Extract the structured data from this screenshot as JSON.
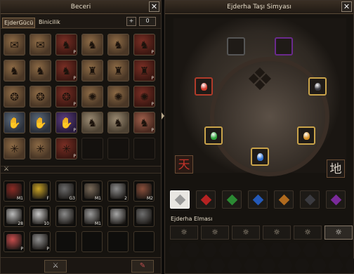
{
  "skills_window": {
    "title": "Beceri",
    "close_label": "✕",
    "tabs": [
      {
        "label": "EjderGücü"
      },
      {
        "label": "Binicilik"
      }
    ],
    "plus_label": "+",
    "skill_points": "0",
    "skill_rows": [
      [
        {
          "kind": "a",
          "icon": "scroll-icon",
          "label": ""
        },
        {
          "kind": "a",
          "icon": "scroll-icon",
          "label": ""
        },
        {
          "kind": "b",
          "icon": "dragon-icon",
          "label": "P"
        },
        {
          "kind": "a",
          "icon": "dragon-icon",
          "label": ""
        },
        {
          "kind": "a",
          "icon": "dragon-icon",
          "label": ""
        },
        {
          "kind": "b",
          "icon": "dragon-icon",
          "label": "P"
        }
      ],
      [
        {
          "kind": "a",
          "icon": "dragon-icon",
          "label": ""
        },
        {
          "kind": "a",
          "icon": "dragon-icon",
          "label": ""
        },
        {
          "kind": "b",
          "icon": "dragon-icon",
          "label": "P"
        },
        {
          "kind": "a",
          "icon": "totem-icon",
          "label": ""
        },
        {
          "kind": "a",
          "icon": "totem-icon",
          "label": ""
        },
        {
          "kind": "b",
          "icon": "totem-icon",
          "label": "P"
        }
      ],
      [
        {
          "kind": "a",
          "icon": "rune-icon",
          "label": ""
        },
        {
          "kind": "a",
          "icon": "rune-icon",
          "label": ""
        },
        {
          "kind": "b",
          "icon": "rune-icon",
          "label": "P"
        },
        {
          "kind": "a",
          "icon": "spiral-icon",
          "label": ""
        },
        {
          "kind": "a",
          "icon": "spiral-icon",
          "label": ""
        },
        {
          "kind": "b",
          "icon": "spiral-icon",
          "label": "P"
        }
      ],
      [
        {
          "kind": "c",
          "icon": "claw-icon",
          "label": ""
        },
        {
          "kind": "c",
          "icon": "claw-icon",
          "label": ""
        },
        {
          "kind": "e",
          "icon": "claw-icon",
          "label": "P"
        },
        {
          "kind": "d",
          "icon": "beast-icon",
          "label": ""
        },
        {
          "kind": "d",
          "icon": "beast-icon",
          "label": ""
        },
        {
          "kind": "f",
          "icon": "beast-icon",
          "label": "P"
        }
      ],
      [
        {
          "kind": "a",
          "icon": "web-icon",
          "label": ""
        },
        {
          "kind": "a",
          "icon": "web-icon",
          "label": ""
        },
        {
          "kind": "b",
          "icon": "web-icon",
          "label": "P"
        },
        {
          "kind": "empty",
          "icon": "",
          "label": ""
        },
        {
          "kind": "empty",
          "icon": "",
          "label": ""
        },
        {
          "kind": "empty",
          "icon": "",
          "label": ""
        }
      ]
    ],
    "items": [
      [
        {
          "icon": "sword-slot-icon",
          "label": "M1",
          "color": "#8a2a24"
        },
        {
          "icon": "yellow-gem-icon",
          "label": "F",
          "color": "#c9a326"
        },
        {
          "icon": "flag-icon",
          "label": "G3",
          "color": "#6b6b6b"
        },
        {
          "icon": "flag-up-icon",
          "label": "M1",
          "color": "#7a6b5a"
        },
        {
          "icon": "armor-icon",
          "label": "2",
          "color": "#8c8c8c"
        },
        {
          "icon": "knot-icon",
          "label": "M2",
          "color": "#8a4f3b"
        }
      ],
      [
        {
          "icon": "horse-icon",
          "label": "28",
          "color": "#bbbbbb"
        },
        {
          "icon": "helm-icon",
          "label": "10",
          "color": "#c8c8c8"
        },
        {
          "icon": "bow-icon",
          "label": "",
          "color": "#8a8a8a"
        },
        {
          "icon": "blade-icon",
          "label": "M1",
          "color": "#9a9a9a"
        },
        {
          "icon": "arrows-icon",
          "label": "",
          "color": "#a6a6a6"
        },
        {
          "icon": "scroll-slot-icon",
          "label": "",
          "color": "#6e6e6e"
        }
      ],
      [
        {
          "icon": "target-icon",
          "label": "P",
          "color": "#c84d4d"
        },
        {
          "icon": "cross-swords-icon",
          "label": "P",
          "color": "#909090"
        },
        {
          "icon": "",
          "label": "",
          "color": ""
        },
        {
          "icon": "",
          "label": "",
          "color": ""
        },
        {
          "icon": "",
          "label": "",
          "color": ""
        },
        {
          "icon": "",
          "label": "",
          "color": ""
        }
      ]
    ]
  },
  "alchemy_window": {
    "title": "Ejderha Taşı Simyası",
    "close_label": "✕",
    "heaven_char": "天",
    "earth_char": "地",
    "sockets": [
      {
        "name": "socket-top-left",
        "gem": "",
        "border": "#555555"
      },
      {
        "name": "socket-top-right",
        "gem": "",
        "border": "#6a2a8c"
      },
      {
        "name": "socket-left",
        "gem": "#d23a2a",
        "border": "#b03b2a"
      },
      {
        "name": "socket-right",
        "gem": "#3a3a40",
        "border": "#c9a34a"
      },
      {
        "name": "socket-lower-left",
        "gem": "#2fa33a",
        "border": "#c9a34a"
      },
      {
        "name": "socket-lower-right",
        "gem": "#d48f24",
        "border": "#c9a34a"
      },
      {
        "name": "socket-bottom",
        "gem": "#2b6fd1",
        "border": "#c9a34a"
      }
    ],
    "gem_tabs": [
      {
        "name": "diamond",
        "color": "#ffffff",
        "active": true
      },
      {
        "name": "ruby",
        "color": "#b52222",
        "active": false
      },
      {
        "name": "jade",
        "color": "#2b8a33",
        "active": false
      },
      {
        "name": "sapphire",
        "color": "#2459b8",
        "active": false
      },
      {
        "name": "garnet",
        "color": "#b06a1e",
        "active": false
      },
      {
        "name": "onyx",
        "color": "#3a3a3f",
        "active": false
      },
      {
        "name": "amethyst",
        "color": "#7a2a9a",
        "active": false
      }
    ],
    "selected_gem_label": "Ejderha Elması",
    "grade_icons": [
      "☼",
      "☼",
      "☼",
      "☼",
      "☼",
      "☼"
    ],
    "active_grade": 5
  }
}
